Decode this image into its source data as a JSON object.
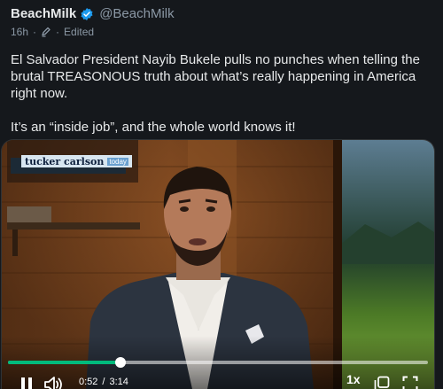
{
  "post": {
    "author": {
      "display_name": "BeachMilk",
      "handle": "@BeachMilk",
      "verified": true
    },
    "meta": {
      "time": "16h",
      "separator": "·",
      "edited_label": "Edited"
    },
    "text": [
      "El Salvador President Nayib Bukele pulls no punches when telling the brutal TREASONOUS truth about what’s really happening in America right now.",
      "It’s an “inside job”, and the whole world knows it!"
    ]
  },
  "video": {
    "lower_third": {
      "show": "tucker carlson",
      "suffix": "today"
    },
    "current_time": "0:52",
    "time_separator": "/",
    "duration": "3:14",
    "progress_fraction": 0.268,
    "speed_label": "1x",
    "state": "playing"
  },
  "icons": [
    "verified-badge-icon",
    "edit-history-icon",
    "pause-icon",
    "volume-icon",
    "picture-in-picture-icon",
    "fullscreen-icon"
  ],
  "colors": {
    "background": "#15181c",
    "text": "#e7e9ea",
    "muted": "#8b98a5",
    "verified": "#1d9bf0",
    "progress": "#00ba7c"
  }
}
